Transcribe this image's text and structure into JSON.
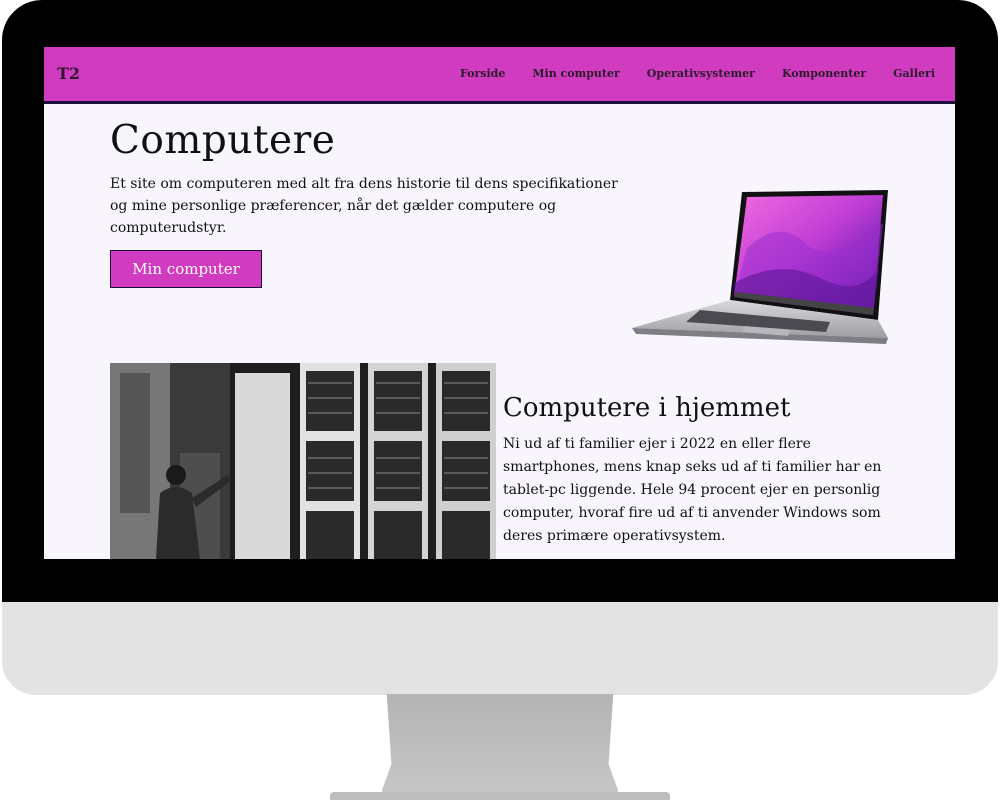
{
  "site": {
    "logo": "T2",
    "nav": [
      "Forside",
      "Min computer",
      "Operativsystemer",
      "Komponenter",
      "Galleri"
    ]
  },
  "hero": {
    "title": "Computere",
    "text": "Et site om computeren med alt fra dens historie til dens specifikationer og mine personlige præferencer, når det gælder computere og computerudstyr.",
    "button": "Min computer"
  },
  "section": {
    "title": "Computere i hjemmet",
    "text": "Ni ud af ti familier ejer i 2022 en eller flere smartphones, mens knap seks ud af ti familier har en tablet-pc liggende. Hele 94 procent ejer en personlig computer, hvoraf fire ud af ti anvender Windows som deres primære operativsystem."
  },
  "colors": {
    "accent": "#d13bc0",
    "nav_border": "#1b0f3e",
    "page_background": "#f9f5fd",
    "bezel": "#000000",
    "chin": "#e3e3e3"
  },
  "icons": {
    "laptop": "laptop-image",
    "photo": "vintage-computer-photo"
  }
}
